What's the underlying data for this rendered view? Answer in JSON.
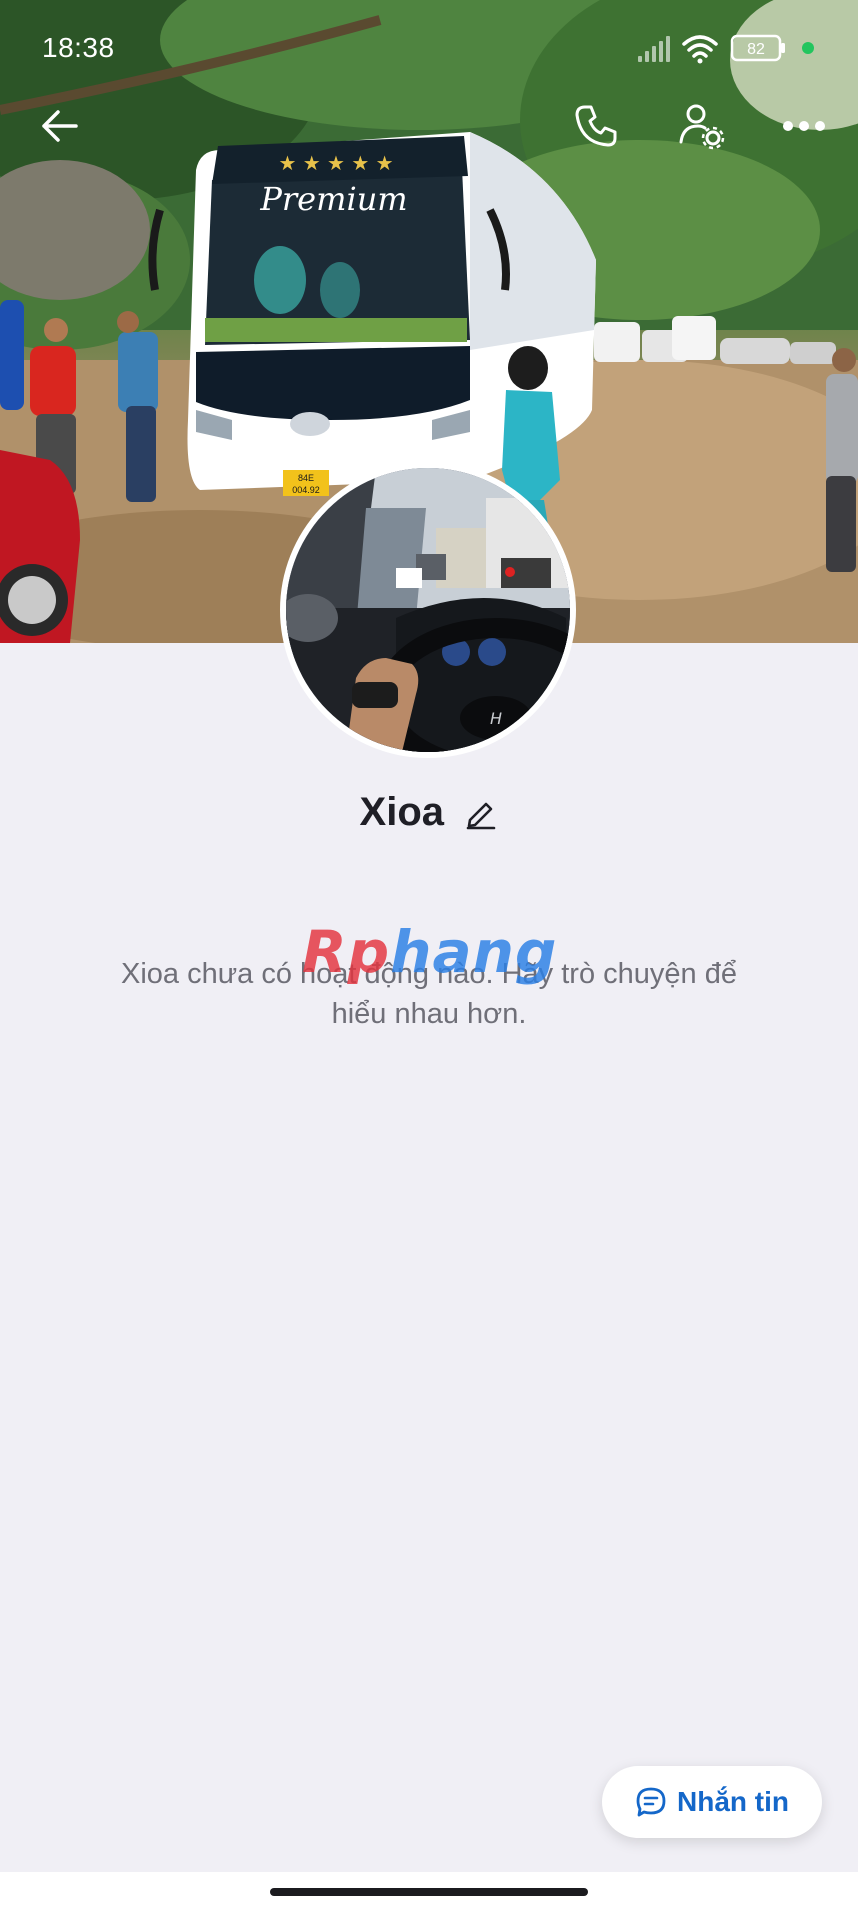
{
  "status_bar": {
    "time": "18:38",
    "battery_level": "82",
    "signal_icon": "cellular-signal-icon",
    "wifi_icon": "wifi-icon",
    "battery_icon": "battery-icon",
    "dot_color": "#22c55e"
  },
  "cover": {
    "bus_sign": "Premium",
    "plate_line1": "84E",
    "plate_line2": "004.92"
  },
  "nav": {
    "back_icon": "back-arrow-icon",
    "call_icon": "phone-icon",
    "settings_icon": "user-settings-icon",
    "more_icon": "more-dots-icon"
  },
  "profile": {
    "name": "Xioa",
    "edit_icon": "pencil-icon"
  },
  "empty_state": {
    "line1": "Xioa chưa có hoạt động nào. Hãy trò chuyện để",
    "line2": "hiểu nhau hơn."
  },
  "watermark": {
    "part1": "Rp",
    "part2": "hang"
  },
  "message_button": {
    "label": "Nhắn tin",
    "icon": "chat-bubble-icon",
    "color": "#1467c9"
  }
}
